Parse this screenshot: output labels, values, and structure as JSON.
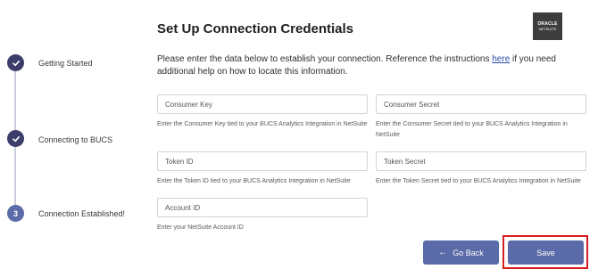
{
  "stepper": {
    "steps": [
      {
        "label": "Getting Started",
        "state": "done"
      },
      {
        "label": "Connecting to BUCS",
        "state": "done"
      },
      {
        "label": "Connection Established!",
        "state": "current",
        "number": "3"
      }
    ]
  },
  "header": {
    "title": "Set Up Connection Credentials",
    "logo_line1": "ORACLE",
    "logo_line2": "NETSUITE"
  },
  "intro": {
    "text_before": "Please enter the data below to establish your connection. Reference the instructions ",
    "link": "here",
    "text_after": " if you need additional help on how to locate this information."
  },
  "fields": {
    "consumer_key": {
      "placeholder": "Consumer Key",
      "value": "",
      "help": "Enter the Consumer Key tied to your BUCS Analytics Integration in NetSuite"
    },
    "consumer_secret": {
      "placeholder": "Consumer Secret",
      "value": "",
      "help": "Enter the Consumer Secret tied to your BUCS Analytics Integration in NetSuite"
    },
    "token_id": {
      "placeholder": "Token ID",
      "value": "",
      "help": "Enter the Token ID tied to your BUCS Analytics Integration in NetSuite"
    },
    "token_secret": {
      "placeholder": "Token Secret",
      "value": "",
      "help": "Enter the Token Secret tied to your BUCS Analytics Integration in NetSuite"
    },
    "account_id": {
      "placeholder": "Account ID",
      "value": "",
      "help": "Enter your NetSuite Account ID"
    }
  },
  "buttons": {
    "back_label": "Go Back",
    "save_label": "Save"
  },
  "colors": {
    "accent": "#5b6aa8",
    "step_done": "#3c3d6b",
    "highlight": "#d61f1f"
  }
}
